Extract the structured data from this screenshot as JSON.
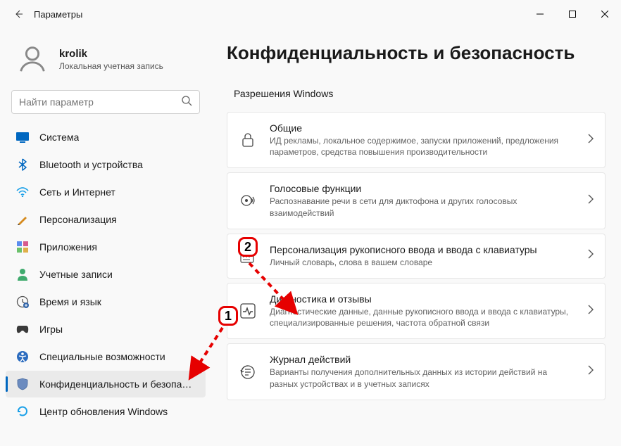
{
  "window": {
    "title": "Параметры"
  },
  "profile": {
    "name": "krolik",
    "sub": "Локальная учетная запись"
  },
  "search": {
    "placeholder": "Найти параметр"
  },
  "sidebar": {
    "items": [
      {
        "label": "Система"
      },
      {
        "label": "Bluetooth и устройства"
      },
      {
        "label": "Сеть и Интернет"
      },
      {
        "label": "Персонализация"
      },
      {
        "label": "Приложения"
      },
      {
        "label": "Учетные записи"
      },
      {
        "label": "Время и язык"
      },
      {
        "label": "Игры"
      },
      {
        "label": "Специальные возможности"
      },
      {
        "label": "Конфиденциальность и безопасность"
      },
      {
        "label": "Центр обновления Windows"
      }
    ]
  },
  "main": {
    "heading": "Конфиденциальность и безопасность",
    "section": "Разрешения Windows",
    "cards": [
      {
        "title": "Общие",
        "desc": "ИД рекламы, локальное содержимое, запуски приложений, предложения параметров, средства повышения производительности"
      },
      {
        "title": "Голосовые функции",
        "desc": "Распознавание речи в сети для диктофона и других голосовых взаимодействий"
      },
      {
        "title": "Персонализация рукописного ввода и ввода с клавиатуры",
        "desc": "Личный словарь, слова в вашем словаре"
      },
      {
        "title": "Диагностика и отзывы",
        "desc": "Диагностические данные, данные рукописного ввода и ввода с клавиатуры, специализированные решения, частота обратной связи"
      },
      {
        "title": "Журнал действий",
        "desc": "Варианты получения дополнительных данных из истории действий на разных устройствах и в учетных записях"
      }
    ]
  },
  "annotations": {
    "one": "1",
    "two": "2"
  }
}
